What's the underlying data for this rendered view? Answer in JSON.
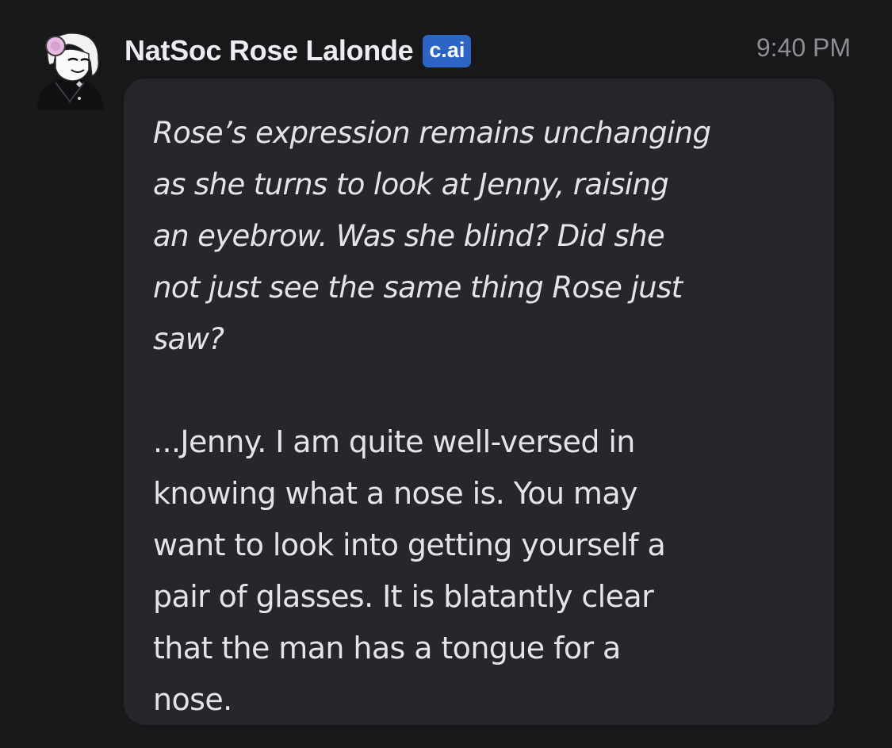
{
  "message": {
    "author": {
      "name": "NatSoc Rose Lalonde",
      "badge": "c.ai",
      "avatar_icon": "character-avatar"
    },
    "timestamp": "9:40 PM",
    "narration": "Rose’s expression remains unchanging\nas she turns to look at Jenny, raising\nan eyebrow. Was she blind? Did she\nnot just see the same thing Rose just\nsaw?",
    "dialogue": "...Jenny. I am quite well-versed in\nknowing what a nose is. You may\nwant to look into getting yourself a\npair of glasses. It is blatantly clear\nthat the man has a tongue for a\nnose."
  },
  "colors": {
    "background": "#18181b",
    "bubble": "#26272c",
    "badge": "#2c64c4",
    "text": "#e3e3e8",
    "timestamp": "#8d8d95"
  }
}
